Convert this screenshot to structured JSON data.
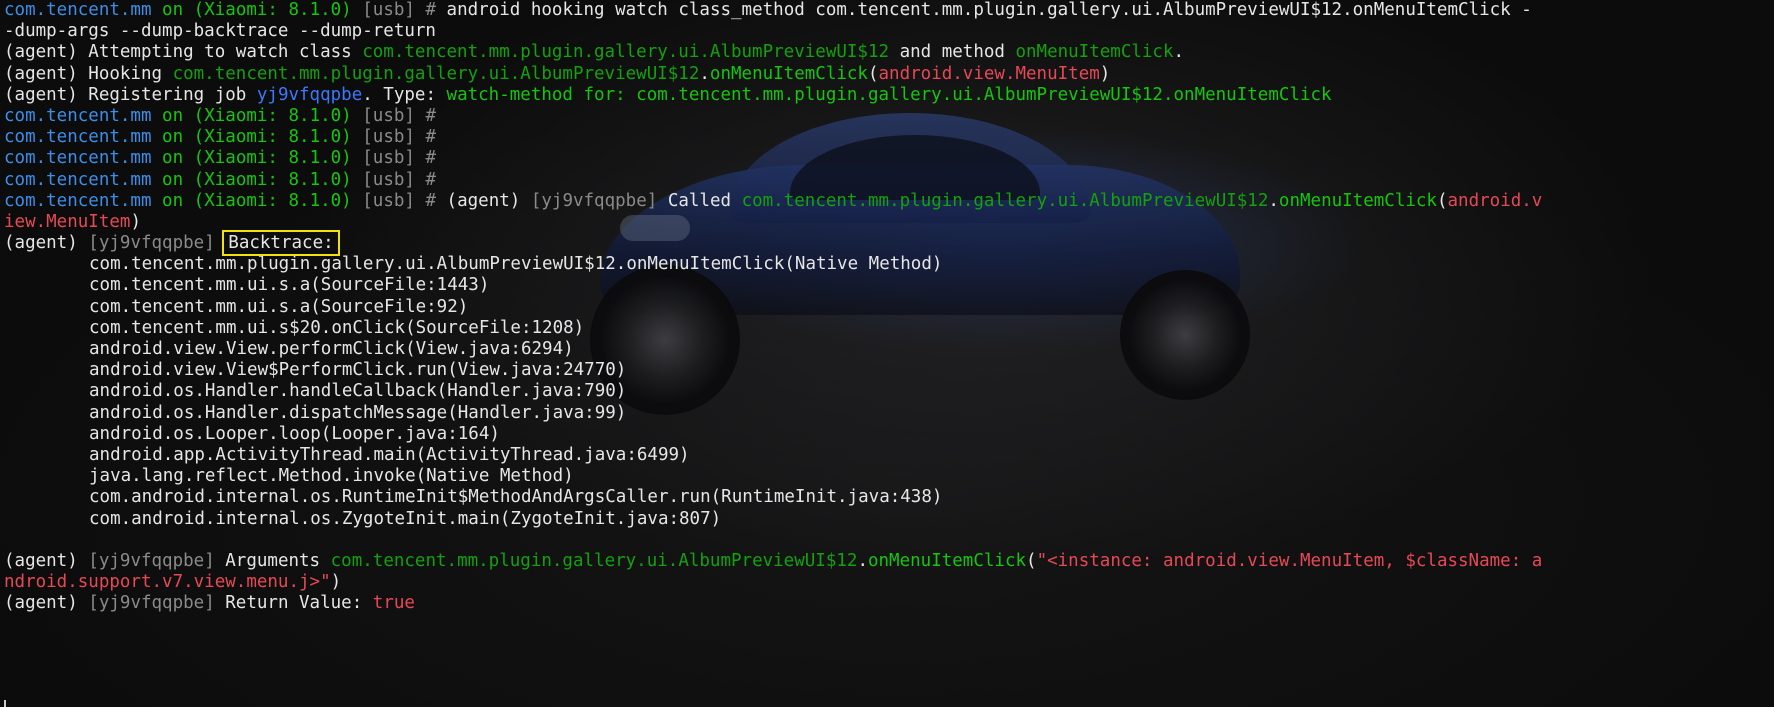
{
  "terminal": {
    "lines": [
      {
        "segments": [
          {
            "text": "com.tencent.mm",
            "color": "#3b8eea"
          },
          {
            "text": " on ",
            "color": "#16c60c"
          },
          {
            "text": "(Xiaomi: 8.1.0)",
            "color": "#16c60c"
          },
          {
            "text": " [usb] # ",
            "color": "#8a8a8a"
          },
          {
            "text": "android hooking watch class_method com.tencent.mm.plugin.gallery.ui.AlbumPreviewUI$12.onMenuItemClick -",
            "color": "#e6e6e6"
          }
        ]
      },
      {
        "segments": [
          {
            "text": "-dump-args --dump-backtrace --dump-return",
            "color": "#e6e6e6"
          }
        ]
      },
      {
        "segments": [
          {
            "text": "(agent) Attempting to watch class ",
            "color": "#e6e6e6"
          },
          {
            "text": "com.tencent.mm.plugin.gallery.ui.AlbumPreviewUI$12",
            "color": "#13a10e"
          },
          {
            "text": " and method ",
            "color": "#e6e6e6"
          },
          {
            "text": "onMenuItemClick",
            "color": "#13a10e"
          },
          {
            "text": ".",
            "color": "#e6e6e6"
          }
        ]
      },
      {
        "segments": [
          {
            "text": "(agent) Hooking ",
            "color": "#e6e6e6"
          },
          {
            "text": "com.tencent.mm.plugin.gallery.ui.AlbumPreviewUI$12",
            "color": "#13a10e"
          },
          {
            "text": ".",
            "color": "#e6e6e6"
          },
          {
            "text": "onMenuItemClick",
            "color": "#16c60c"
          },
          {
            "text": "(",
            "color": "#e6e6e6"
          },
          {
            "text": "android.view.MenuItem",
            "color": "#e74856"
          },
          {
            "text": ")",
            "color": "#e6e6e6"
          }
        ]
      },
      {
        "segments": [
          {
            "text": "(agent) Registering job ",
            "color": "#e6e6e6"
          },
          {
            "text": "yj9vfqqpbe",
            "color": "#3b78ff"
          },
          {
            "text": ". Type: ",
            "color": "#e6e6e6"
          },
          {
            "text": "watch-method for: com.tencent.mm.plugin.gallery.ui.AlbumPreviewUI$12.onMenuItemClick",
            "color": "#16c60c"
          }
        ]
      },
      {
        "segments": [
          {
            "text": "com.tencent.mm",
            "color": "#3b8eea"
          },
          {
            "text": " on ",
            "color": "#16c60c"
          },
          {
            "text": "(Xiaomi: 8.1.0)",
            "color": "#16c60c"
          },
          {
            "text": " [usb] #",
            "color": "#8a8a8a"
          }
        ]
      },
      {
        "segments": [
          {
            "text": "com.tencent.mm",
            "color": "#3b8eea"
          },
          {
            "text": " on ",
            "color": "#16c60c"
          },
          {
            "text": "(Xiaomi: 8.1.0)",
            "color": "#16c60c"
          },
          {
            "text": " [usb] #",
            "color": "#8a8a8a"
          }
        ]
      },
      {
        "segments": [
          {
            "text": "com.tencent.mm",
            "color": "#3b8eea"
          },
          {
            "text": " on ",
            "color": "#16c60c"
          },
          {
            "text": "(Xiaomi: 8.1.0)",
            "color": "#16c60c"
          },
          {
            "text": " [usb] #",
            "color": "#8a8a8a"
          }
        ]
      },
      {
        "segments": [
          {
            "text": "com.tencent.mm",
            "color": "#3b8eea"
          },
          {
            "text": " on ",
            "color": "#16c60c"
          },
          {
            "text": "(Xiaomi: 8.1.0)",
            "color": "#16c60c"
          },
          {
            "text": " [usb] #",
            "color": "#8a8a8a"
          }
        ]
      },
      {
        "segments": [
          {
            "text": "com.tencent.mm",
            "color": "#3b8eea"
          },
          {
            "text": " on ",
            "color": "#16c60c"
          },
          {
            "text": "(Xiaomi: 8.1.0)",
            "color": "#16c60c"
          },
          {
            "text": " [usb] # ",
            "color": "#8a8a8a"
          },
          {
            "text": "(agent) ",
            "color": "#e6e6e6"
          },
          {
            "text": "[yj9vfqqpbe]",
            "color": "#8a8a8a"
          },
          {
            "text": " Called ",
            "color": "#e6e6e6"
          },
          {
            "text": "com.tencent.mm.plugin.gallery.ui.AlbumPreviewUI$12",
            "color": "#13a10e"
          },
          {
            "text": ".",
            "color": "#e6e6e6"
          },
          {
            "text": "onMenuItemClick",
            "color": "#16c60c"
          },
          {
            "text": "(",
            "color": "#e6e6e6"
          },
          {
            "text": "android.v",
            "color": "#e74856"
          }
        ]
      },
      {
        "segments": [
          {
            "text": "iew.MenuItem",
            "color": "#e74856"
          },
          {
            "text": ")",
            "color": "#e6e6e6"
          }
        ]
      },
      {
        "segments": [
          {
            "text": "(agent) ",
            "color": "#e6e6e6"
          },
          {
            "text": "[yj9vfqqpbe]",
            "color": "#8a8a8a"
          },
          {
            "text": " ",
            "color": "#e6e6e6"
          },
          {
            "text": "Backtrace:",
            "color": "#e6e6e6",
            "boxed": true
          }
        ]
      },
      {
        "indent": true,
        "segments": [
          {
            "text": "com.tencent.mm.plugin.gallery.ui.AlbumPreviewUI$12.onMenuItemClick(Native Method)",
            "color": "#e6e6e6"
          }
        ]
      },
      {
        "indent": true,
        "segments": [
          {
            "text": "com.tencent.mm.ui.s.a(SourceFile:1443)",
            "color": "#e6e6e6"
          }
        ]
      },
      {
        "indent": true,
        "segments": [
          {
            "text": "com.tencent.mm.ui.s.a(SourceFile:92)",
            "color": "#e6e6e6"
          }
        ]
      },
      {
        "indent": true,
        "segments": [
          {
            "text": "com.tencent.mm.ui.s$20.onClick(SourceFile:1208)",
            "color": "#e6e6e6"
          }
        ]
      },
      {
        "indent": true,
        "segments": [
          {
            "text": "android.view.View.performClick(View.java:6294)",
            "color": "#e6e6e6"
          }
        ]
      },
      {
        "indent": true,
        "segments": [
          {
            "text": "android.view.View$PerformClick.run(View.java:24770)",
            "color": "#e6e6e6"
          }
        ]
      },
      {
        "indent": true,
        "segments": [
          {
            "text": "android.os.Handler.handleCallback(Handler.java:790)",
            "color": "#e6e6e6"
          }
        ]
      },
      {
        "indent": true,
        "segments": [
          {
            "text": "android.os.Handler.dispatchMessage(Handler.java:99)",
            "color": "#e6e6e6"
          }
        ]
      },
      {
        "indent": true,
        "segments": [
          {
            "text": "android.os.Looper.loop(Looper.java:164)",
            "color": "#e6e6e6"
          }
        ]
      },
      {
        "indent": true,
        "segments": [
          {
            "text": "android.app.ActivityThread.main(ActivityThread.java:6499)",
            "color": "#e6e6e6"
          }
        ]
      },
      {
        "indent": true,
        "segments": [
          {
            "text": "java.lang.reflect.Method.invoke(Native Method)",
            "color": "#e6e6e6"
          }
        ]
      },
      {
        "indent": true,
        "segments": [
          {
            "text": "com.android.internal.os.RuntimeInit$MethodAndArgsCaller.run(RuntimeInit.java:438)",
            "color": "#e6e6e6"
          }
        ]
      },
      {
        "indent": true,
        "segments": [
          {
            "text": "com.android.internal.os.ZygoteInit.main(ZygoteInit.java:807)",
            "color": "#e6e6e6"
          }
        ]
      },
      {
        "segments": [
          {
            "text": "",
            "color": "#e6e6e6"
          }
        ]
      },
      {
        "segments": [
          {
            "text": "(agent) ",
            "color": "#e6e6e6"
          },
          {
            "text": "[yj9vfqqpbe]",
            "color": "#8a8a8a"
          },
          {
            "text": " Arguments ",
            "color": "#e6e6e6"
          },
          {
            "text": "com.tencent.mm.plugin.gallery.ui.AlbumPreviewUI$12",
            "color": "#13a10e"
          },
          {
            "text": ".",
            "color": "#e6e6e6"
          },
          {
            "text": "onMenuItemClick",
            "color": "#16c60c"
          },
          {
            "text": "(",
            "color": "#e6e6e6"
          },
          {
            "text": "\"<instance: android.view.MenuItem, $className: a",
            "color": "#e74856"
          }
        ]
      },
      {
        "segments": [
          {
            "text": "ndroid.support.v7.view.menu.j>\"",
            "color": "#e74856"
          },
          {
            "text": ")",
            "color": "#e6e6e6"
          }
        ]
      },
      {
        "segments": [
          {
            "text": "(agent) ",
            "color": "#e6e6e6"
          },
          {
            "text": "[yj9vfqqpbe]",
            "color": "#8a8a8a"
          },
          {
            "text": " Return Value: ",
            "color": "#e6e6e6"
          },
          {
            "text": "true",
            "color": "#e74856"
          }
        ]
      }
    ]
  }
}
